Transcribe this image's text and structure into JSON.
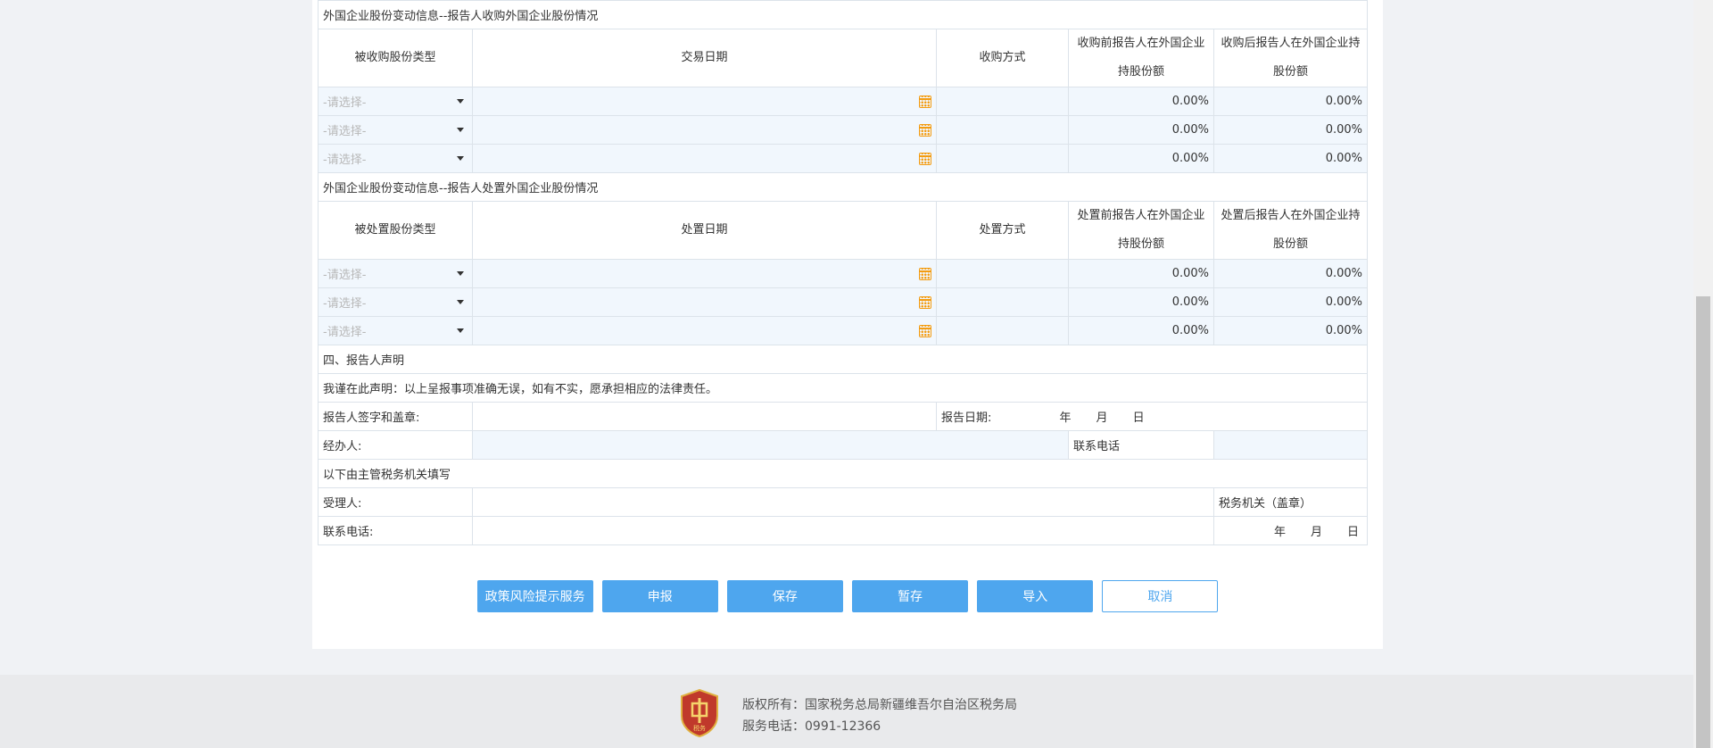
{
  "acquire": {
    "section_title": "外国企业股份变动信息--报告人收购外国企业股份情况",
    "headers": [
      "被收购股份类型",
      "交易日期",
      "收购方式",
      "收购前报告人在外国企业持股份额",
      "收购后报告人在外国企业持股份额"
    ],
    "rows": [
      {
        "type": "-请选择-",
        "before": "0.00%",
        "after": "0.00%"
      },
      {
        "type": "-请选择-",
        "before": "0.00%",
        "after": "0.00%"
      },
      {
        "type": "-请选择-",
        "before": "0.00%",
        "after": "0.00%"
      }
    ]
  },
  "dispose": {
    "section_title": "外国企业股份变动信息--报告人处置外国企业股份情况",
    "headers": [
      "被处置股份类型",
      "处置日期",
      "处置方式",
      "处置前报告人在外国企业持股份额",
      "处置后报告人在外国企业持股份额"
    ],
    "rows": [
      {
        "type": "-请选择-",
        "before": "0.00%",
        "after": "0.00%"
      },
      {
        "type": "-请选择-",
        "before": "0.00%",
        "after": "0.00%"
      },
      {
        "type": "-请选择-",
        "before": "0.00%",
        "after": "0.00%"
      }
    ]
  },
  "declaration": {
    "section_title": "四、报告人声明",
    "statement": "我谨在此声明：以上呈报事项准确无误，如有不实，愿承担相应的法律责任。",
    "sign_label": "报告人签字和盖章:",
    "date_label": "报告日期:",
    "year": "年",
    "month": "月",
    "day": "日",
    "agent_label": "经办人:",
    "phone_label": "联系电话"
  },
  "tax_office": {
    "section_title": "以下由主管税务机关填写",
    "receiver_label": "受理人:",
    "seal_label": "税务机关（盖章）",
    "phone_label": "联系电话:",
    "year": "年",
    "month": "月",
    "day": "日"
  },
  "buttons": {
    "policy": "政策风险提示服务",
    "declare": "申报",
    "save": "保存",
    "temp_save": "暂存",
    "import": "导入",
    "cancel": "取消"
  },
  "footer": {
    "copyright": "版权所有：国家税务总局新疆维吾尔自治区税务局",
    "service_phone": "服务电话：0991-12366",
    "emblem_text": "税务"
  },
  "colors": {
    "accent": "#4ea6ee",
    "percent": "#2b8fd6",
    "calendar_icon": "#f39c12",
    "fill_cell": "#f1f7fd",
    "emblem": "#c0392b"
  }
}
